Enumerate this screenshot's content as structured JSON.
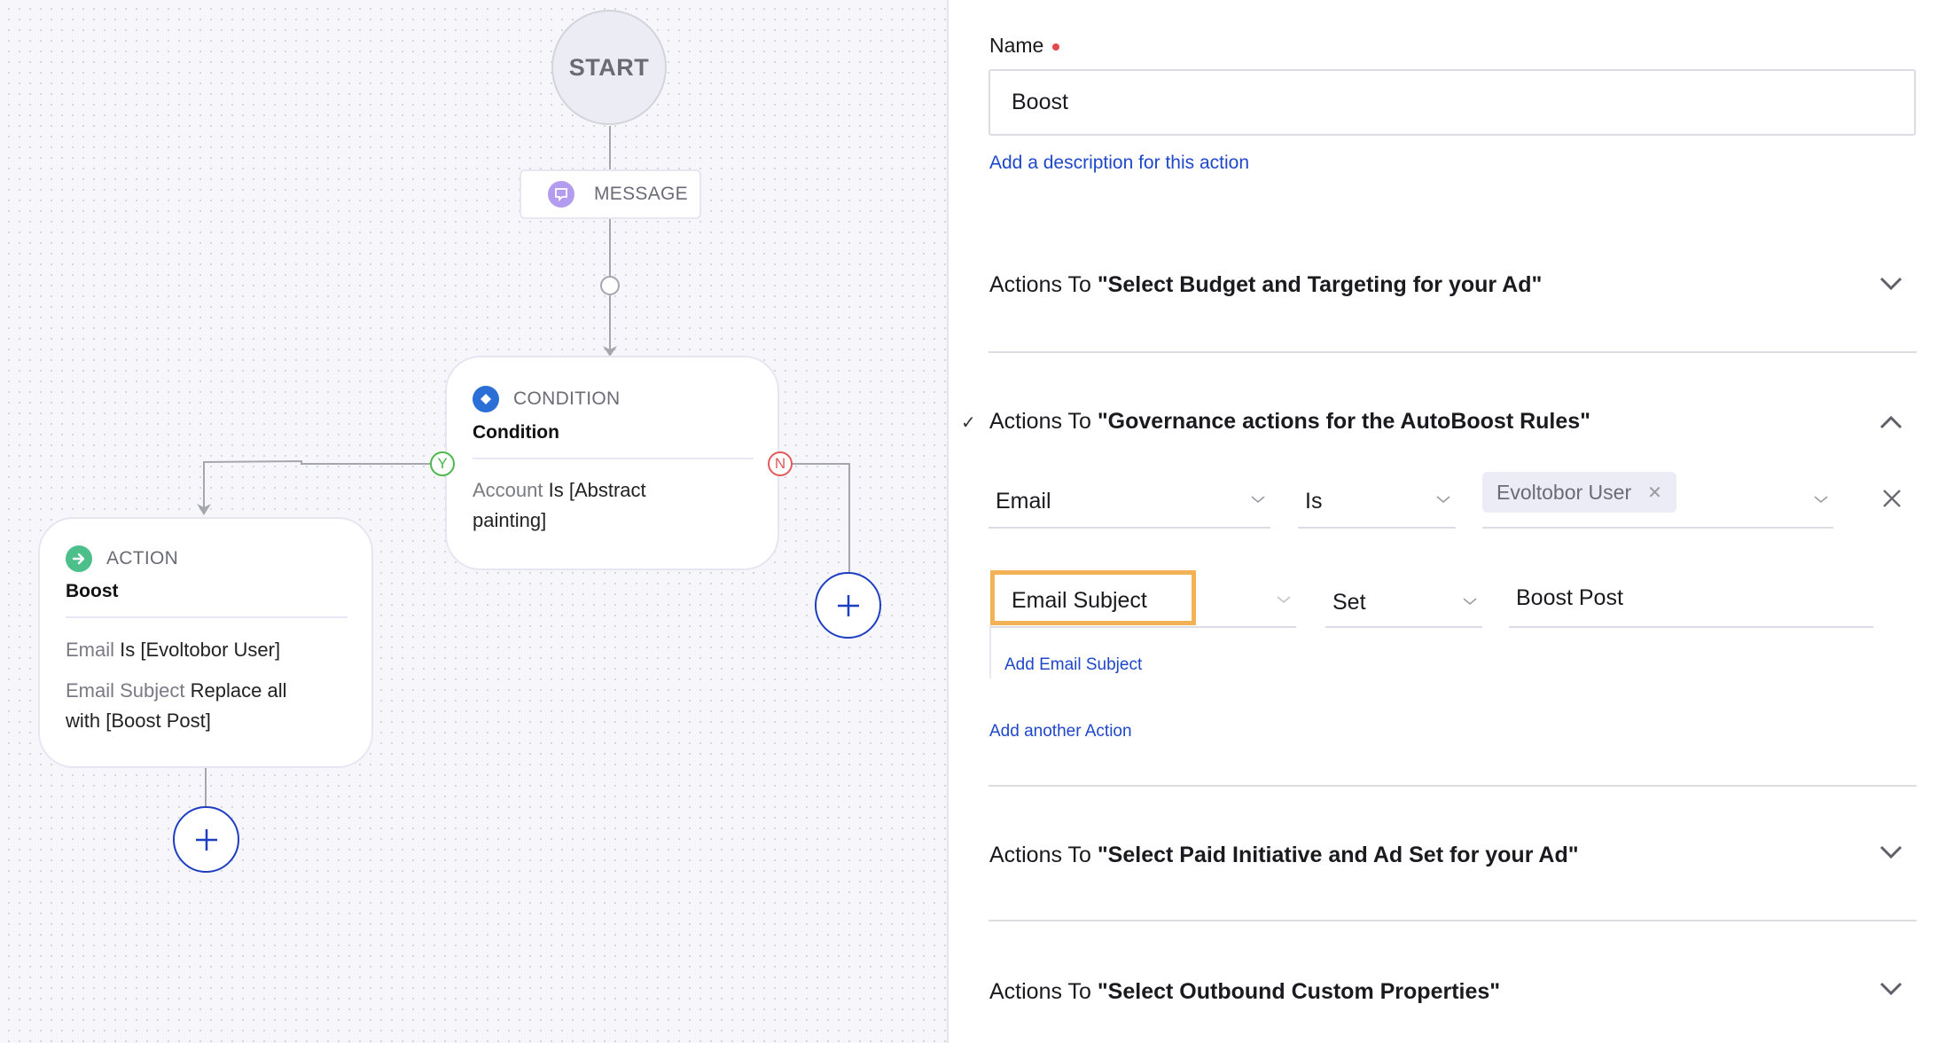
{
  "canvas": {
    "start_label": "START",
    "message_node": {
      "label": "MESSAGE",
      "icon": "chat-bubble-icon"
    },
    "condition_node": {
      "kind": "CONDITION",
      "title": "Condition",
      "icon": "diamond-icon",
      "rules": [
        {
          "field": "Account",
          "text": "Is [Abstract",
          "text2": "painting]"
        }
      ],
      "yes_label": "Y",
      "no_label": "N"
    },
    "action_node": {
      "kind": "ACTION",
      "title": "Boost",
      "icon": "arrow-right-icon",
      "rules": [
        {
          "field": "Email",
          "text": "Is [Evoltobor User]"
        },
        {
          "field": "Email Subject",
          "text": "Replace all",
          "text2": "with [Boost Post]"
        }
      ]
    },
    "add_node_symbol": "+"
  },
  "panel": {
    "name_label": "Name",
    "name_value": "Boost",
    "add_description": "Add a description for this action",
    "sections": [
      {
        "prefix": "Actions To ",
        "title": "\"Select Budget and Targeting for your Ad\"",
        "expanded": false,
        "completed": false
      },
      {
        "prefix": "Actions To ",
        "title": "\"Governance actions for the AutoBoost Rules\"",
        "expanded": true,
        "completed": true
      },
      {
        "prefix": "Actions To ",
        "title": "\"Select Paid Initiative and Ad Set for your Ad\"",
        "expanded": false,
        "completed": false
      },
      {
        "prefix": "Actions To ",
        "title": "\"Select Outbound Custom Properties\"",
        "expanded": false,
        "completed": false
      }
    ],
    "condition_row": {
      "field": "Email",
      "operator": "Is",
      "values": [
        "Evoltobor User"
      ]
    },
    "action_row": {
      "field": "Email Subject",
      "operator": "Set",
      "value": "Boost Post"
    },
    "add_field_link": "Add Email Subject",
    "add_action_link": "Add another Action",
    "check_mark": "✓"
  },
  "colors": {
    "accent_link": "#1f47c9",
    "highlight": "#f3b256",
    "yes": "#4cb84c",
    "no": "#e25a5a",
    "condition_icon": "#2a6fd6",
    "action_icon": "#4cbf8a",
    "message_icon": "#b39cf0"
  }
}
